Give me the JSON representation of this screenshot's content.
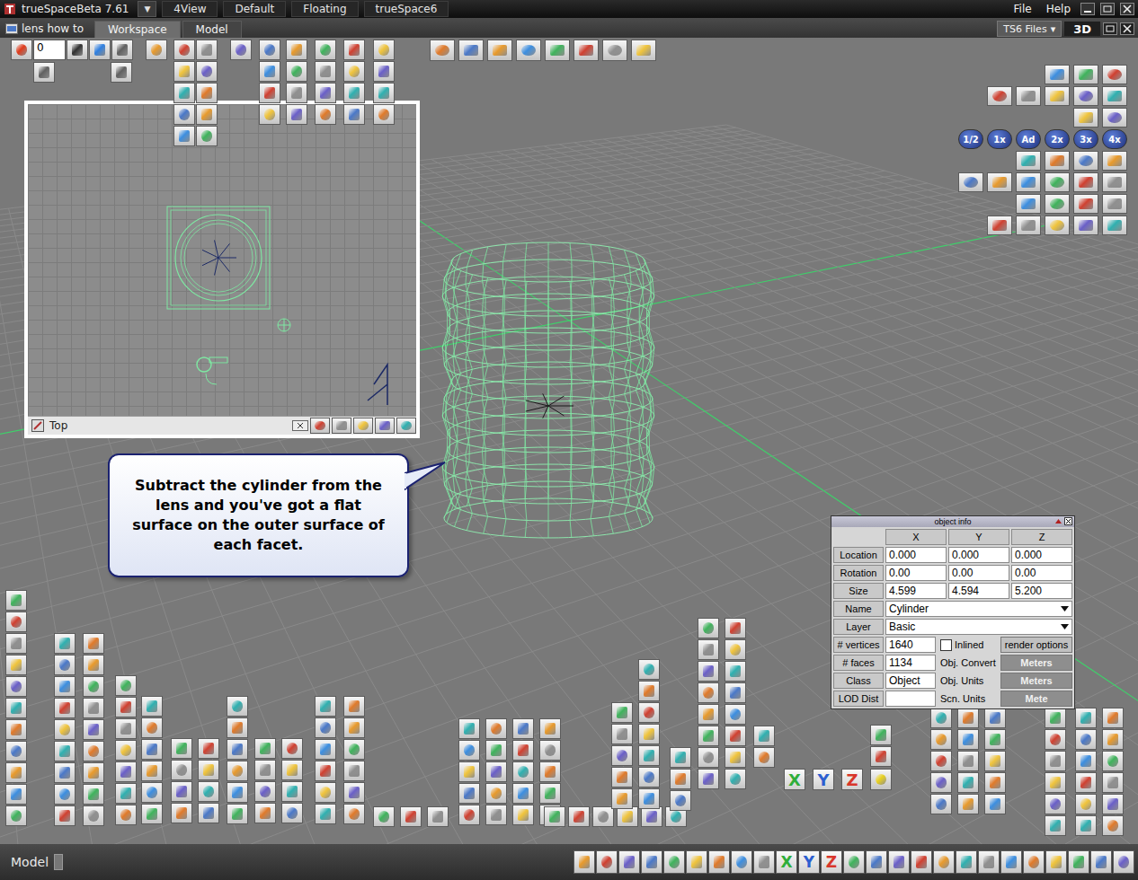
{
  "window": {
    "title": "trueSpaceBeta 7.61",
    "menu_arrow": "▼",
    "layouts": [
      {
        "label": "4View",
        "selected": false
      },
      {
        "label": "Default",
        "selected": false
      },
      {
        "label": "Floating",
        "selected": false
      },
      {
        "label": "trueSpace6",
        "selected": false
      }
    ],
    "menu": [
      "File",
      "Help"
    ]
  },
  "scene": "lens how to",
  "tabs": [
    {
      "label": "Workspace",
      "selected": true
    },
    {
      "label": "Model",
      "selected": false
    }
  ],
  "files": {
    "label": "TS6 Files",
    "arrow": "▾"
  },
  "view_button": {
    "label": "3D",
    "selected": true
  },
  "frame": "0",
  "top_view": {
    "title": "Top"
  },
  "callout": "Subtract the cylinder from the lens and you've got a flat surface on the outer surface of each facet.",
  "object_info": {
    "title": "object info",
    "columns": [
      "X",
      "Y",
      "Z"
    ],
    "rows": [
      {
        "label": "Location",
        "values": [
          "0.000",
          "0.000",
          "0.000"
        ]
      },
      {
        "label": "Rotation",
        "values": [
          "0.00",
          "0.00",
          "0.00"
        ]
      },
      {
        "label": "Size",
        "values": [
          "4.599",
          "4.594",
          "5.200"
        ]
      }
    ],
    "name": {
      "label": "Name",
      "value": "Cylinder"
    },
    "layer": {
      "label": "Layer",
      "value": "Basic"
    },
    "vertices": {
      "label": "# vertices",
      "value": "1640"
    },
    "inlined": {
      "label": "Inlined",
      "checked": false
    },
    "render_options": "render options",
    "faces": {
      "label": "# faces",
      "value": "1134"
    },
    "class": {
      "label": "Class",
      "value": "Object"
    },
    "lod": {
      "label": "LOD Dist",
      "value": ""
    },
    "units": [
      {
        "label": "Obj. Convert",
        "value": "Meters"
      },
      {
        "label": "Obj. Units",
        "value": "Meters"
      },
      {
        "label": "Scn. Units",
        "value": "Mete"
      }
    ]
  },
  "render_buttons": [
    "1/2",
    "1x",
    "Ad",
    "2x",
    "3x",
    "4x"
  ],
  "axis_buttons": [
    {
      "label": "X",
      "color": "#2fae3a"
    },
    {
      "label": "Y",
      "color": "#2c5fd0"
    },
    {
      "label": "Z",
      "color": "#d8362b"
    }
  ],
  "status": {
    "label": "Model",
    "axis_buttons": [
      {
        "label": "X",
        "color": "#2fae3a"
      },
      {
        "label": "Y",
        "color": "#2c5fd0"
      },
      {
        "label": "Z",
        "color": "#d8362b"
      }
    ]
  }
}
